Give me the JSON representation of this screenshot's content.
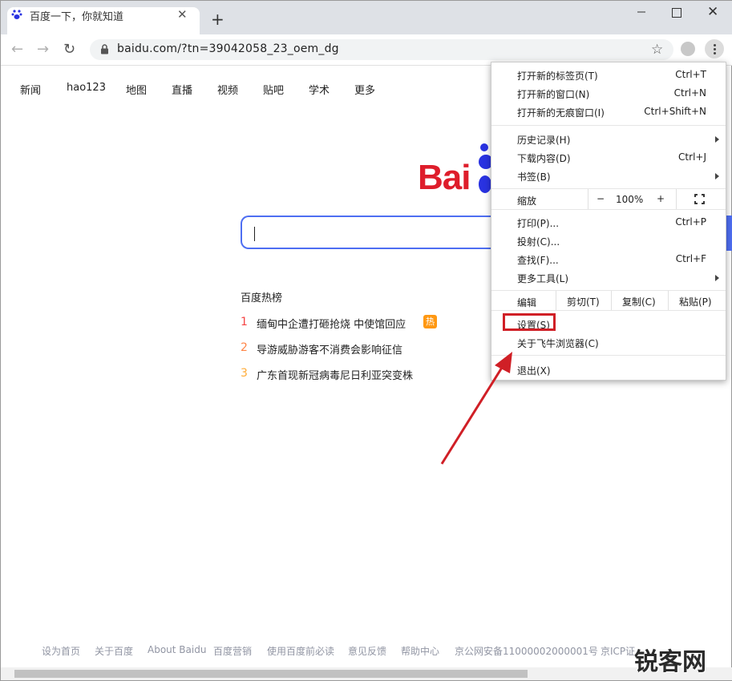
{
  "tab": {
    "title": "百度一下，你就知道",
    "close_label": "✕"
  },
  "toolbar": {
    "url": "baidu.com/?tn=39042058_23_oem_dg"
  },
  "page": {
    "nav": [
      "新闻",
      "hao123",
      "地图",
      "直播",
      "视频",
      "贴吧",
      "学术",
      "更多"
    ],
    "logo_text": "Bai",
    "hot_title": "百度热榜",
    "hot_items": [
      {
        "rank": "1",
        "text": "缅甸中企遭打砸抢烧 中使馆回应",
        "badge": "热",
        "color": "#f54545"
      },
      {
        "rank": "2",
        "text": "导游威胁游客不消费会影响征信",
        "color": "#ff8547"
      },
      {
        "rank": "3",
        "text": "广东首现新冠病毒尼日利亚突变株",
        "color": "#ffac38"
      }
    ],
    "footer": [
      "设为首页",
      "关于百度",
      "About Baidu",
      "百度营销",
      "使用百度前必读",
      "意见反馈",
      "帮助中心",
      "京公网安备11000002000001号",
      "京ICP证"
    ]
  },
  "menu": {
    "new_tab": {
      "label": "打开新的标签页(T)",
      "shortcut": "Ctrl+T"
    },
    "new_window": {
      "label": "打开新的窗口(N)",
      "shortcut": "Ctrl+N"
    },
    "incognito": {
      "label": "打开新的无痕窗口(I)",
      "shortcut": "Ctrl+Shift+N"
    },
    "history": {
      "label": "历史记录(H)"
    },
    "downloads": {
      "label": "下载内容(D)",
      "shortcut": "Ctrl+J"
    },
    "bookmarks": {
      "label": "书签(B)"
    },
    "zoom": {
      "label": "缩放",
      "minus": "−",
      "value": "100%",
      "plus": "+"
    },
    "print": {
      "label": "打印(P)...",
      "shortcut": "Ctrl+P"
    },
    "cast": {
      "label": "投射(C)..."
    },
    "find": {
      "label": "查找(F)...",
      "shortcut": "Ctrl+F"
    },
    "more_tools": {
      "label": "更多工具(L)"
    },
    "edit": {
      "label": "编辑",
      "cut": "剪切(T)",
      "copy": "复制(C)",
      "paste": "粘贴(P)"
    },
    "settings": {
      "label": "设置(S)"
    },
    "about": {
      "label": "关于飞牛浏览器(C)"
    },
    "exit": {
      "label": "退出(X)"
    }
  },
  "annotation": {
    "highlight_color": "#d01f26",
    "watermark": "锐客网"
  }
}
